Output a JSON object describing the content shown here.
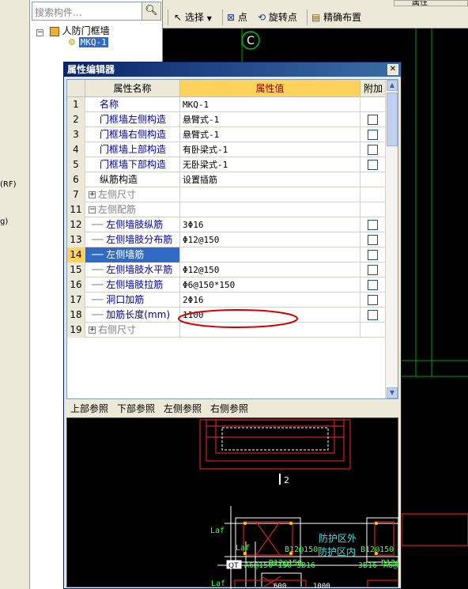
{
  "left_panel": {
    "fragments": [
      "(RF)",
      "g)"
    ],
    "search": {
      "placeholder": "搜索构件..."
    },
    "tree": {
      "root_label": "人防门框墙",
      "child_label": "MKQ-1"
    }
  },
  "top_right": {
    "label": "属性"
  },
  "toolbar": {
    "select_label": "选择",
    "point_label": "点",
    "rotate_point_label": "旋转点",
    "precise_label": "精确布置"
  },
  "canvas": {
    "axis_label": "C"
  },
  "dialog": {
    "title": "属性编辑器",
    "columns": {
      "name": "属性名称",
      "value": "属性值",
      "add": "附加"
    },
    "rows": [
      {
        "num": "1",
        "name": "名称",
        "value": "MKQ-1",
        "indent": 1,
        "checkbox": false
      },
      {
        "num": "2",
        "name": "门框墙左侧构造",
        "value": "悬臂式-1",
        "indent": 1,
        "checkbox": true
      },
      {
        "num": "3",
        "name": "门框墙右侧构造",
        "value": "悬臂式-1",
        "indent": 1,
        "checkbox": true
      },
      {
        "num": "4",
        "name": "门框墙上部构造",
        "value": "有卧梁式-1",
        "indent": 1,
        "checkbox": true
      },
      {
        "num": "5",
        "name": "门框墙下部构造",
        "value": "无卧梁式-1",
        "indent": 1,
        "checkbox": true
      },
      {
        "num": "6",
        "name": "纵筋构造",
        "value": "设置插筋",
        "indent": 1,
        "checkbox": false,
        "plain": true
      },
      {
        "num": "7",
        "name": "左侧尺寸",
        "value": "",
        "indent": 0,
        "checkbox": false,
        "group": "+"
      },
      {
        "num": "11",
        "name": "左侧配筋",
        "value": "",
        "indent": 0,
        "checkbox": false,
        "group": "−"
      },
      {
        "num": "12",
        "name": "左侧墙肢纵筋",
        "value": "3Φ16",
        "indent": 2,
        "checkbox": true
      },
      {
        "num": "13",
        "name": "左侧墙肢分布筋",
        "value": "Φ12@150",
        "indent": 2,
        "checkbox": true
      },
      {
        "num": "14",
        "name": "左侧墙筋",
        "value": "",
        "indent": 2,
        "checkbox": true,
        "selected": true
      },
      {
        "num": "15",
        "name": "左侧墙肢水平筋",
        "value": "Φ12@150",
        "indent": 2,
        "checkbox": true
      },
      {
        "num": "16",
        "name": "左侧墙肢拉筋",
        "value": "Φ6@150*150",
        "indent": 2,
        "checkbox": true
      },
      {
        "num": "17",
        "name": "洞口加筋",
        "value": "2Φ16",
        "indent": 2,
        "checkbox": true
      },
      {
        "num": "18",
        "name": "加筋长度(mm)",
        "value": "1100",
        "indent": 2,
        "checkbox": true
      },
      {
        "num": "19",
        "name": "右侧尺寸",
        "value": "",
        "indent": 0,
        "checkbox": false,
        "group": "+"
      }
    ],
    "tabs": [
      "上部参照",
      "下部参照",
      "左侧参照",
      "右侧参照"
    ],
    "highlight_color": "#d40000"
  },
  "drawing": {
    "label_2": "2",
    "outside_label": "防护区外",
    "inside_label": "防护区内",
    "qt_label": "QT",
    "rebar_top_left": "A6@150*150",
    "rebar_3b16_left": "3B16",
    "rebar_3b16_right": "3B16",
    "rebar_a6_right": "A6@",
    "laf_1": "Laf",
    "laf_2": "Laf",
    "b12_1": "B12@150",
    "b12_2": "B12@150",
    "b12_3": "B12@150",
    "b12_4": "B12@",
    "dim_600": "600",
    "dim_1000": "1000"
  }
}
